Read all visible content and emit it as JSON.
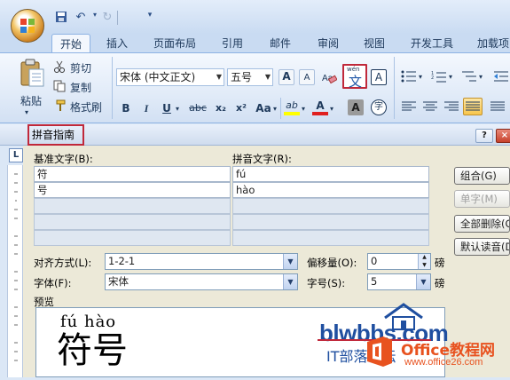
{
  "tabs": [
    "开始",
    "插入",
    "页面布局",
    "引用",
    "邮件",
    "审阅",
    "视图",
    "开发工具",
    "加载项"
  ],
  "ribbon": {
    "paste_label": "粘贴",
    "cut_label": "剪切",
    "copy_label": "复制",
    "format_painter_label": "格式刷",
    "font_name": "宋体 (中文正文)",
    "font_size": "五号",
    "phonetic_guide_wen": "wén",
    "phonetic_guide_char": "文",
    "char_border": "A",
    "grow_font": "A",
    "shrink_font": "A",
    "bold": "B",
    "italic": "I",
    "underline": "U",
    "strike": "abc",
    "subscript": "x₂",
    "superscript": "x²",
    "change_case": "Aa",
    "highlight": "ab",
    "font_color": "A",
    "char_shading": "A",
    "enclose_char": "字"
  },
  "dialog": {
    "title": "拼音指南",
    "help": "?",
    "base_text_label": "基准文字(B):",
    "ruby_text_label": "拼音文字(R):",
    "rows": [
      {
        "base": "符",
        "ruby": "fú"
      },
      {
        "base": "号",
        "ruby": "hào"
      },
      {
        "base": "",
        "ruby": ""
      },
      {
        "base": "",
        "ruby": ""
      },
      {
        "base": "",
        "ruby": ""
      }
    ],
    "buttons": {
      "group": "组合(G)",
      "mono": "单字(M)",
      "clear_all": "全部删除(C)",
      "default_reading": "默认读音(D)"
    },
    "align_label": "对齐方式(L):",
    "align_value": "1-2-1",
    "offset_label": "偏移量(O):",
    "offset_value": "0",
    "offset_unit": "磅",
    "font_label": "字体(F):",
    "font_value": "宋体",
    "size_label": "字号(S):",
    "size_value": "5",
    "size_unit": "磅",
    "preview_label": "预览",
    "preview_ruby": "fú hào",
    "preview_base": "符号"
  },
  "watermarks": {
    "blw_text": "blwbbs.com",
    "blw_sub": "IT部落论坛",
    "office_text": "Office教程网",
    "office_url": "www.office26.com"
  },
  "colors": {
    "highlight_red": "#c0283a",
    "ribbon_blue": "#1e395b"
  }
}
